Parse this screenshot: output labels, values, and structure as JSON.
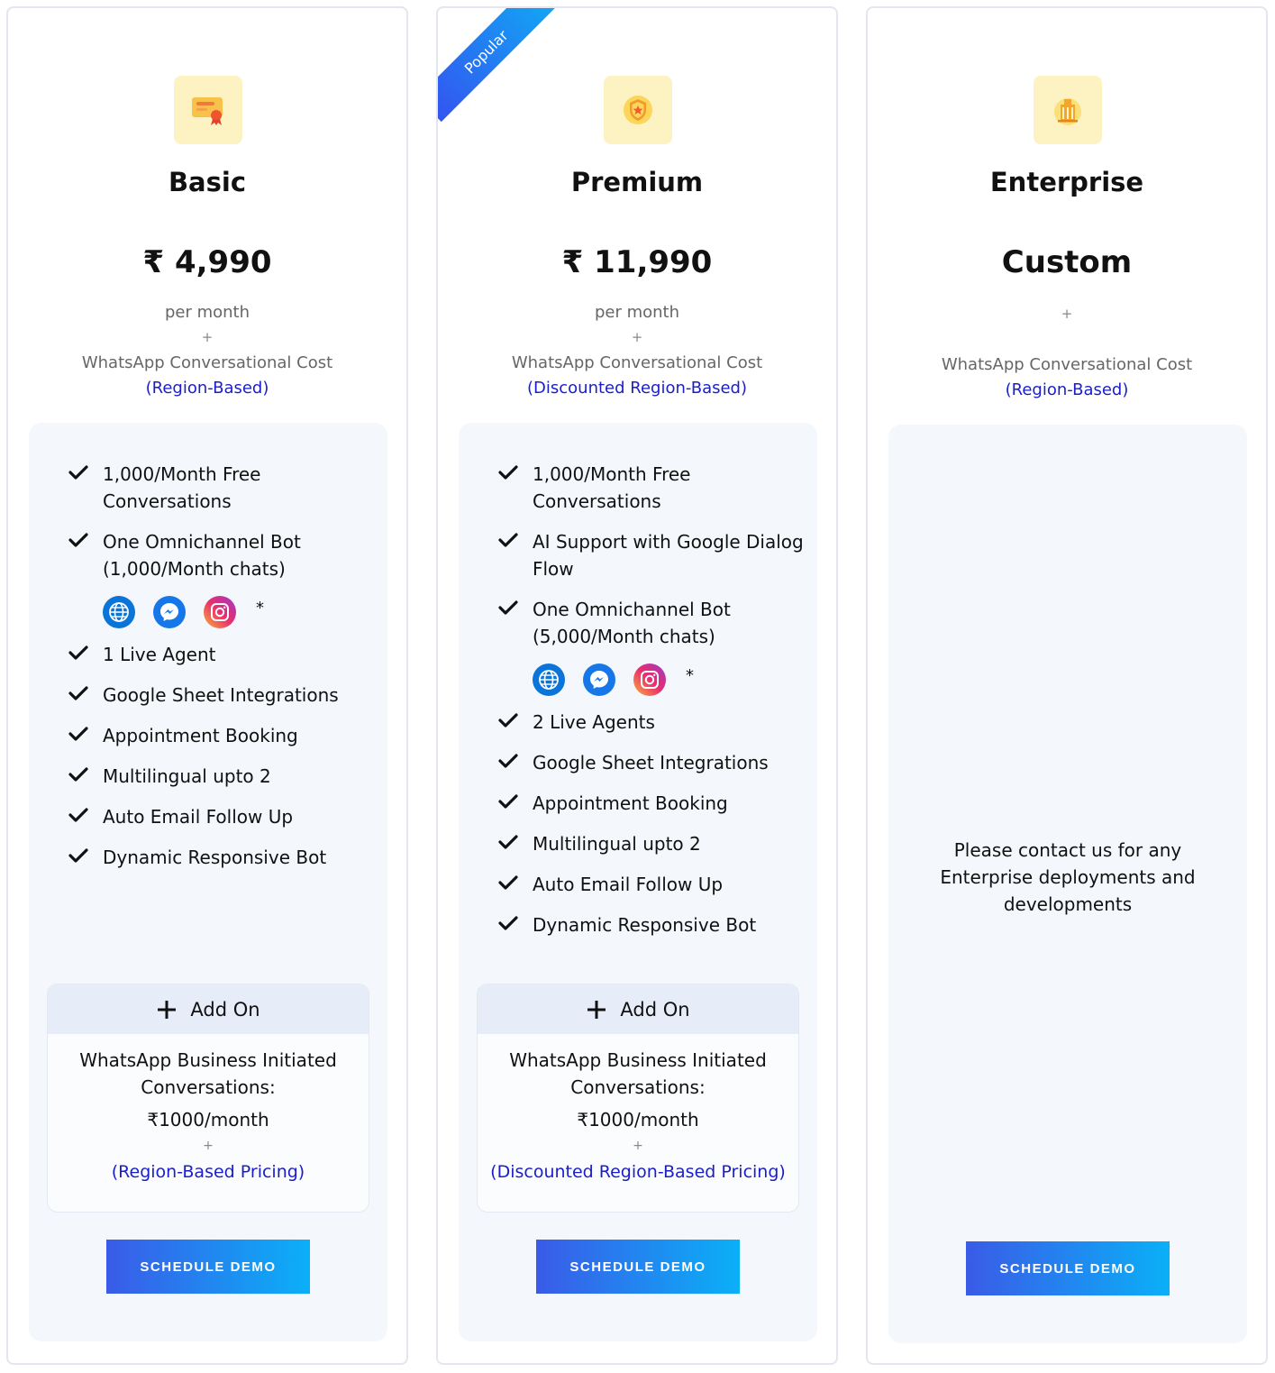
{
  "plans": [
    {
      "name": "Basic",
      "price": "₹ 4,990",
      "period": "per month",
      "plus": "+",
      "cost_label": "WhatsApp Conversational Cost",
      "region": "(Region-Based)",
      "features": [
        "1,000/Month Free Conversations",
        "One Omnichannel Bot (1,000/Month chats)",
        "1 Live Agent",
        "Google Sheet Integrations",
        "Appointment Booking",
        "Multilingual upto 2",
        "Auto Email Follow Up",
        "Dynamic Responsive Bot"
      ],
      "channels_asterisk": "*",
      "addon": {
        "title": "Add On",
        "desc": "WhatsApp Business Initiated Conversations:",
        "price": "₹1000/month",
        "plus": "+",
        "region": "(Region-Based Pricing)"
      },
      "cta": "SCHEDULE DEMO"
    },
    {
      "name": "Premium",
      "ribbon": "Popular",
      "price": "₹ 11,990",
      "period": "per month",
      "plus": "+",
      "cost_label": "WhatsApp Conversational Cost",
      "region": "(Discounted Region-Based)",
      "features": [
        "1,000/Month Free Conversations",
        "AI Support with Google Dialog Flow",
        "One Omnichannel Bot (5,000/Month chats)",
        "2 Live Agents",
        "Google Sheet Integrations",
        "Appointment Booking",
        "Multilingual upto 2",
        "Auto Email Follow Up",
        "Dynamic Responsive Bot"
      ],
      "channels_asterisk": "*",
      "addon": {
        "title": "Add On",
        "desc": "WhatsApp Business Initiated Conversations:",
        "price": "₹1000/month",
        "plus": "+",
        "region": "(Discounted Region-Based Pricing)"
      },
      "cta": "SCHEDULE DEMO"
    },
    {
      "name": "Enterprise",
      "price": "Custom",
      "plus": "+",
      "cost_label": "WhatsApp Conversational Cost",
      "region": "(Region-Based)",
      "message": "Please contact us for any Enterprise deployments and developments",
      "cta": "SCHEDULE DEMO"
    }
  ],
  "icons": {
    "basic": "certificate-icon",
    "premium": "shield-badge-icon",
    "enterprise": "building-icon",
    "channels": [
      "globe-icon",
      "messenger-icon",
      "instagram-icon"
    ],
    "feature": "check-icon",
    "addon": "plus-icon"
  },
  "colors": {
    "accent_blue": "#1a1ec9",
    "cta_gradient_start": "#3a5be8",
    "cta_gradient_end": "#0ab0f7",
    "icon_bg": "#fdf2c2",
    "panel_bg": "#f4f7fc"
  }
}
